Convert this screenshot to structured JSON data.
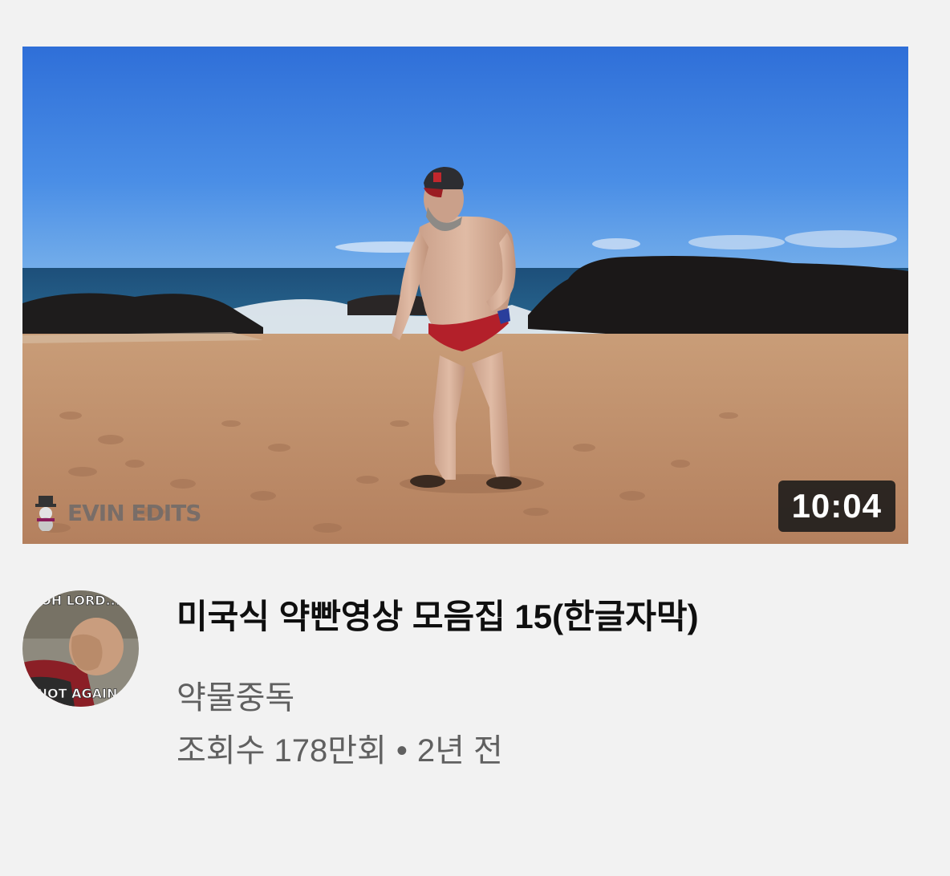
{
  "video": {
    "title": "미국식 약빤영상 모음집 15(한글자막)",
    "duration": "10:04",
    "watermark": "EVIN EDITS",
    "channel": "약물중독",
    "views": "조회수 178만회",
    "separator": "•",
    "age": "2년 전"
  },
  "avatar": {
    "top_text": "OH LORD...",
    "bottom_text": "NOT AGAIN"
  }
}
